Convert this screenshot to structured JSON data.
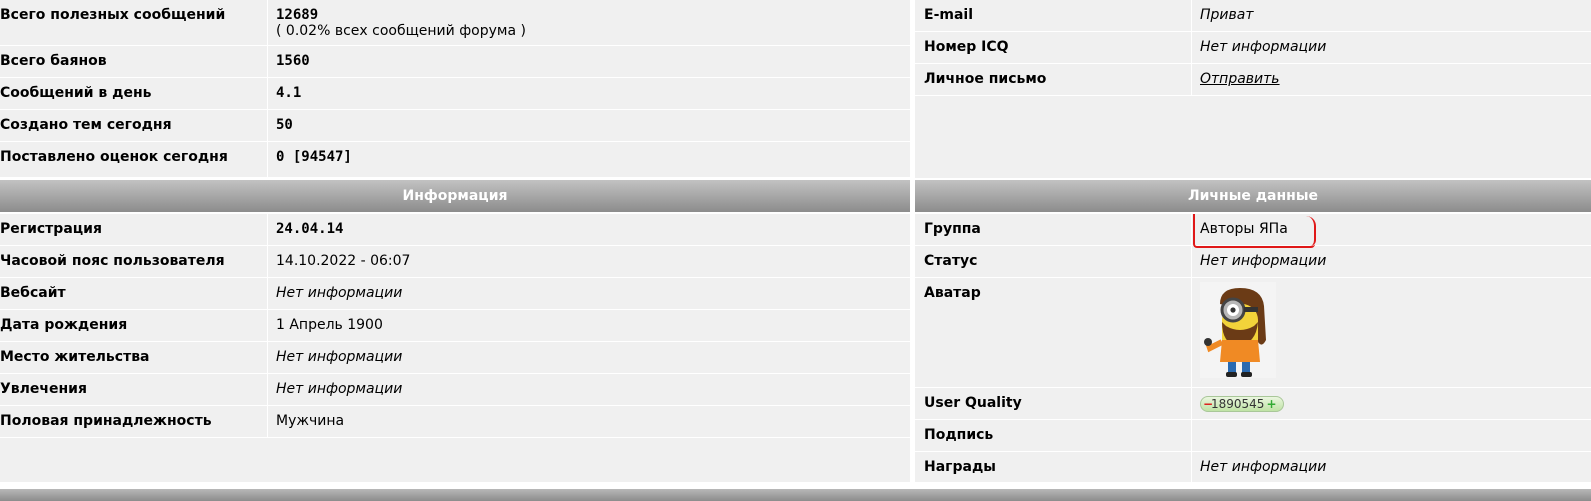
{
  "stats": {
    "rows": [
      {
        "label": "Всего полезных сообщений",
        "value": "12689",
        "sub": "( 0.02% всех сообщений форума )"
      },
      {
        "label": "Всего баянов",
        "value": "1560"
      },
      {
        "label": "Сообщений в день",
        "value": "4.1"
      },
      {
        "label": "Создано тем сегодня",
        "value": "50"
      },
      {
        "label": "Поставлено оценок сегодня",
        "value": "0 [94547]"
      }
    ]
  },
  "contacts": {
    "rows": [
      {
        "label": "E-mail",
        "value": "Приват"
      },
      {
        "label": "Номер ICQ",
        "value": "Нет информации"
      },
      {
        "label": "Личное письмо",
        "value": "Отправить"
      }
    ]
  },
  "info": {
    "title": "Информация",
    "rows": [
      {
        "label": "Регистрация",
        "value": "24.04.14"
      },
      {
        "label": "Часовой пояс пользователя",
        "value": "14.10.2022 - 06:07"
      },
      {
        "label": "Вебсайт",
        "value": "Нет информации"
      },
      {
        "label": "Дата рождения",
        "value": "1 Апрель 1900"
      },
      {
        "label": "Место жительства",
        "value": "Нет информации"
      },
      {
        "label": "Увлечения",
        "value": "Нет информации"
      },
      {
        "label": "Половая принадлежность",
        "value": "Мужчина"
      }
    ]
  },
  "personal": {
    "title": "Личные данные",
    "rows": [
      {
        "label": "Группа",
        "value": "Авторы ЯПа"
      },
      {
        "label": "Статус",
        "value": "Нет информации"
      },
      {
        "label": "Аватар",
        "value": ""
      },
      {
        "label": "User Quality",
        "value": "1890545"
      },
      {
        "label": "Подпись",
        "value": ""
      },
      {
        "label": "Награды",
        "value": "Нет информации"
      }
    ]
  },
  "colors": {
    "accent_red": "#e01818",
    "header_top": "#c2c2c2",
    "header_bottom": "#8c8c8c",
    "panel_bg": "#f0f0f0"
  }
}
